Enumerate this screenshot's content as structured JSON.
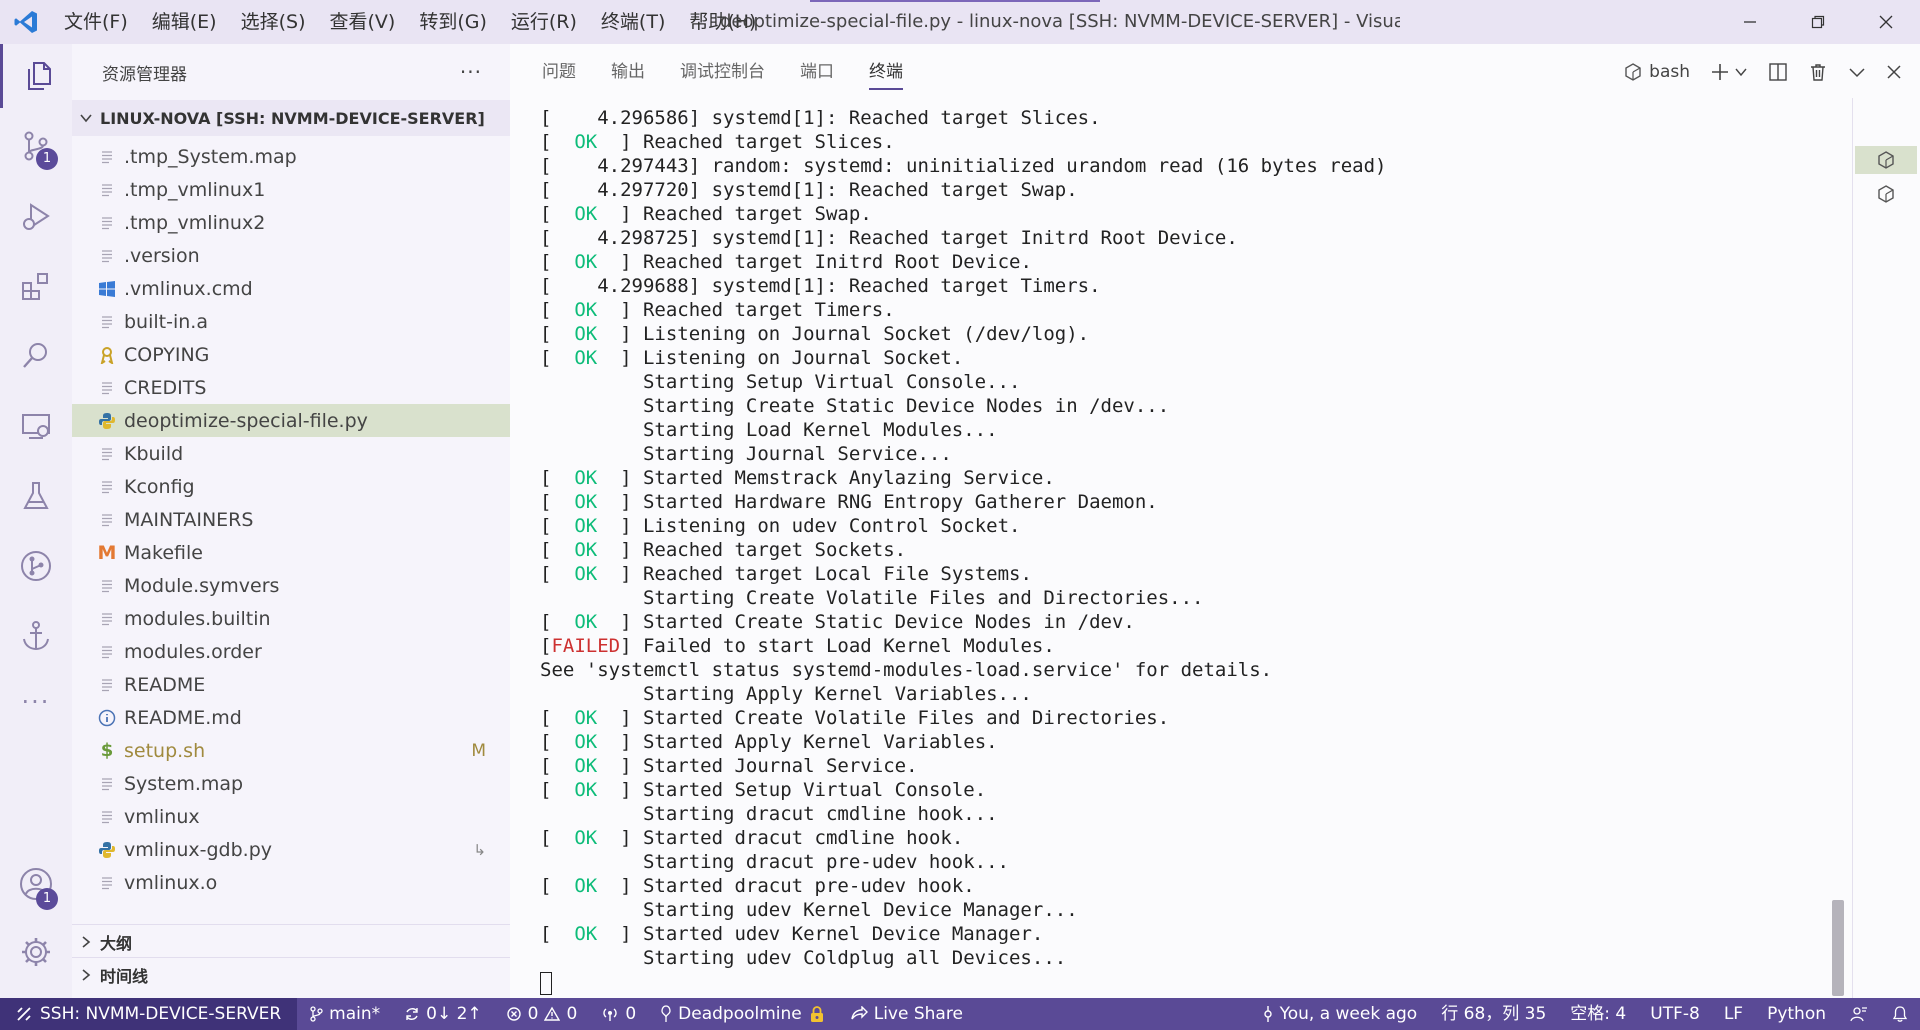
{
  "window": {
    "title": "deoptimize-special-file.py - linux-nova [SSH: NVMM-DEVICE-SERVER] - Visual Studio Code",
    "accent": "#5a4a96"
  },
  "menu": [
    "文件(F)",
    "编辑(E)",
    "选择(S)",
    "查看(V)",
    "转到(G)",
    "运行(R)",
    "终端(T)",
    "帮助(H)"
  ],
  "activity": {
    "scm_badge": "1",
    "account_badge": "1"
  },
  "sidebar": {
    "header": "资源管理器",
    "more": "···",
    "root": "LINUX-NOVA [SSH: NVMM-DEVICE-SERVER]",
    "files": [
      {
        "name": ".tmp_System.map",
        "icon": "file-lines-icon"
      },
      {
        "name": ".tmp_vmlinux1",
        "icon": "file-lines-icon"
      },
      {
        "name": ".tmp_vmlinux2",
        "icon": "file-lines-icon"
      },
      {
        "name": ".version",
        "icon": "file-lines-icon"
      },
      {
        "name": ".vmlinux.cmd",
        "icon": "windows-icon"
      },
      {
        "name": "built-in.a",
        "icon": "file-lines-icon"
      },
      {
        "name": "COPYING",
        "icon": "license-icon"
      },
      {
        "name": "CREDITS",
        "icon": "file-lines-icon"
      },
      {
        "name": "deoptimize-special-file.py",
        "icon": "python-icon",
        "selected": true
      },
      {
        "name": "Kbuild",
        "icon": "file-lines-icon"
      },
      {
        "name": "Kconfig",
        "icon": "file-lines-icon"
      },
      {
        "name": "MAINTAINERS",
        "icon": "file-lines-icon"
      },
      {
        "name": "Makefile",
        "icon": "makefile-icon"
      },
      {
        "name": "Module.symvers",
        "icon": "file-lines-icon"
      },
      {
        "name": "modules.builtin",
        "icon": "file-lines-icon"
      },
      {
        "name": "modules.order",
        "icon": "file-lines-icon"
      },
      {
        "name": "README",
        "icon": "file-lines-icon"
      },
      {
        "name": "README.md",
        "icon": "info-icon"
      },
      {
        "name": "setup.sh",
        "icon": "shell-icon",
        "decoration": "M",
        "modified": true
      },
      {
        "name": "System.map",
        "icon": "file-lines-icon"
      },
      {
        "name": "vmlinux",
        "icon": "file-lines-icon"
      },
      {
        "name": "vmlinux-gdb.py",
        "icon": "python-icon",
        "decoration": "↳"
      },
      {
        "name": "vmlinux.o",
        "icon": "file-lines-icon"
      }
    ],
    "outline": "大纲",
    "timeline": "时间线"
  },
  "panel": {
    "tabs": [
      "问题",
      "输出",
      "调试控制台",
      "端口",
      "终端"
    ],
    "active_tab": 4,
    "shell": "bash"
  },
  "terminal": {
    "lines": [
      {
        "s": "[ ",
        "t": "   4.296586] systemd[1]: Reached target Slices."
      },
      {
        "s": "[  ",
        "ok": "OK",
        "t": "  ] Reached target Slices."
      },
      {
        "s": "[ ",
        "t": "   4.297443] random: systemd: uninitialized urandom read (16 bytes read)"
      },
      {
        "s": "[ ",
        "t": "   4.297720] systemd[1]: Reached target Swap."
      },
      {
        "s": "[  ",
        "ok": "OK",
        "t": "  ] Reached target Swap."
      },
      {
        "s": "[ ",
        "t": "   4.298725] systemd[1]: Reached target Initrd Root Device."
      },
      {
        "s": "[  ",
        "ok": "OK",
        "t": "  ] Reached target Initrd Root Device."
      },
      {
        "s": "[ ",
        "t": "   4.299688] systemd[1]: Reached target Timers."
      },
      {
        "s": "[  ",
        "ok": "OK",
        "t": "  ] Reached target Timers."
      },
      {
        "s": "[  ",
        "ok": "OK",
        "t": "  ] Listening on Journal Socket (/dev/log)."
      },
      {
        "s": "[  ",
        "ok": "OK",
        "t": "  ] Listening on Journal Socket."
      },
      {
        "t": "         Starting Setup Virtual Console..."
      },
      {
        "t": "         Starting Create Static Device Nodes in /dev..."
      },
      {
        "t": "         Starting Load Kernel Modules..."
      },
      {
        "t": "         Starting Journal Service..."
      },
      {
        "s": "[  ",
        "ok": "OK",
        "t": "  ] Started Memstrack Anylazing Service."
      },
      {
        "s": "[  ",
        "ok": "OK",
        "t": "  ] Started Hardware RNG Entropy Gatherer Daemon."
      },
      {
        "s": "[  ",
        "ok": "OK",
        "t": "  ] Listening on udev Control Socket."
      },
      {
        "s": "[  ",
        "ok": "OK",
        "t": "  ] Reached target Sockets."
      },
      {
        "s": "[  ",
        "ok": "OK",
        "t": "  ] Reached target Local File Systems."
      },
      {
        "t": "         Starting Create Volatile Files and Directories..."
      },
      {
        "s": "[  ",
        "ok": "OK",
        "t": "  ] Started Create Static Device Nodes in /dev."
      },
      {
        "s": "[",
        "failed": "FAILED",
        "t": "] Failed to start Load Kernel Modules."
      },
      {
        "t": "See 'systemctl status systemd-modules-load.service' for details."
      },
      {
        "t": "         Starting Apply Kernel Variables..."
      },
      {
        "s": "[  ",
        "ok": "OK",
        "t": "  ] Started Create Volatile Files and Directories."
      },
      {
        "s": "[  ",
        "ok": "OK",
        "t": "  ] Started Apply Kernel Variables."
      },
      {
        "s": "[  ",
        "ok": "OK",
        "t": "  ] Started Journal Service."
      },
      {
        "s": "[  ",
        "ok": "OK",
        "t": "  ] Started Setup Virtual Console."
      },
      {
        "t": "         Starting dracut cmdline hook..."
      },
      {
        "s": "[  ",
        "ok": "OK",
        "t": "  ] Started dracut cmdline hook."
      },
      {
        "t": "         Starting dracut pre-udev hook..."
      },
      {
        "s": "[  ",
        "ok": "OK",
        "t": "  ] Started dracut pre-udev hook."
      },
      {
        "t": "         Starting udev Kernel Device Manager..."
      },
      {
        "s": "[  ",
        "ok": "OK",
        "t": "  ] Started udev Kernel Device Manager."
      },
      {
        "t": "         Starting udev Coldplug all Devices..."
      }
    ],
    "ok_color": "#0dbc79",
    "failed_color": "#cd3131"
  },
  "statusbar": {
    "remote": "SSH: NVMM-DEVICE-SERVER",
    "branch": "main*",
    "sync": "0↓ 2↑",
    "errors": "0",
    "warnings": "0",
    "ports": "0",
    "user": "Deadpoolmine",
    "liveshare": "Live Share",
    "blame": "You, a week ago",
    "position": "行 68，列 35",
    "spaces": "空格: 4",
    "encoding": "UTF-8",
    "eol": "LF",
    "language": "Python"
  }
}
